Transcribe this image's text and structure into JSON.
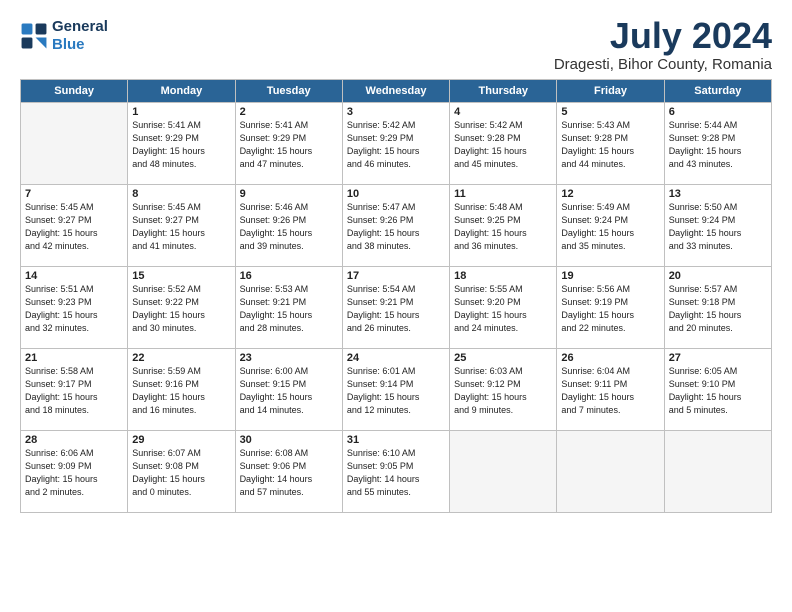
{
  "logo": {
    "line1": "General",
    "line2": "Blue"
  },
  "title": "July 2024",
  "subtitle": "Dragesti, Bihor County, Romania",
  "days_of_week": [
    "Sunday",
    "Monday",
    "Tuesday",
    "Wednesday",
    "Thursday",
    "Friday",
    "Saturday"
  ],
  "weeks": [
    [
      {
        "day": "",
        "detail": ""
      },
      {
        "day": "1",
        "detail": "Sunrise: 5:41 AM\nSunset: 9:29 PM\nDaylight: 15 hours\nand 48 minutes."
      },
      {
        "day": "2",
        "detail": "Sunrise: 5:41 AM\nSunset: 9:29 PM\nDaylight: 15 hours\nand 47 minutes."
      },
      {
        "day": "3",
        "detail": "Sunrise: 5:42 AM\nSunset: 9:29 PM\nDaylight: 15 hours\nand 46 minutes."
      },
      {
        "day": "4",
        "detail": "Sunrise: 5:42 AM\nSunset: 9:28 PM\nDaylight: 15 hours\nand 45 minutes."
      },
      {
        "day": "5",
        "detail": "Sunrise: 5:43 AM\nSunset: 9:28 PM\nDaylight: 15 hours\nand 44 minutes."
      },
      {
        "day": "6",
        "detail": "Sunrise: 5:44 AM\nSunset: 9:28 PM\nDaylight: 15 hours\nand 43 minutes."
      }
    ],
    [
      {
        "day": "7",
        "detail": "Sunrise: 5:45 AM\nSunset: 9:27 PM\nDaylight: 15 hours\nand 42 minutes."
      },
      {
        "day": "8",
        "detail": "Sunrise: 5:45 AM\nSunset: 9:27 PM\nDaylight: 15 hours\nand 41 minutes."
      },
      {
        "day": "9",
        "detail": "Sunrise: 5:46 AM\nSunset: 9:26 PM\nDaylight: 15 hours\nand 39 minutes."
      },
      {
        "day": "10",
        "detail": "Sunrise: 5:47 AM\nSunset: 9:26 PM\nDaylight: 15 hours\nand 38 minutes."
      },
      {
        "day": "11",
        "detail": "Sunrise: 5:48 AM\nSunset: 9:25 PM\nDaylight: 15 hours\nand 36 minutes."
      },
      {
        "day": "12",
        "detail": "Sunrise: 5:49 AM\nSunset: 9:24 PM\nDaylight: 15 hours\nand 35 minutes."
      },
      {
        "day": "13",
        "detail": "Sunrise: 5:50 AM\nSunset: 9:24 PM\nDaylight: 15 hours\nand 33 minutes."
      }
    ],
    [
      {
        "day": "14",
        "detail": "Sunrise: 5:51 AM\nSunset: 9:23 PM\nDaylight: 15 hours\nand 32 minutes."
      },
      {
        "day": "15",
        "detail": "Sunrise: 5:52 AM\nSunset: 9:22 PM\nDaylight: 15 hours\nand 30 minutes."
      },
      {
        "day": "16",
        "detail": "Sunrise: 5:53 AM\nSunset: 9:21 PM\nDaylight: 15 hours\nand 28 minutes."
      },
      {
        "day": "17",
        "detail": "Sunrise: 5:54 AM\nSunset: 9:21 PM\nDaylight: 15 hours\nand 26 minutes."
      },
      {
        "day": "18",
        "detail": "Sunrise: 5:55 AM\nSunset: 9:20 PM\nDaylight: 15 hours\nand 24 minutes."
      },
      {
        "day": "19",
        "detail": "Sunrise: 5:56 AM\nSunset: 9:19 PM\nDaylight: 15 hours\nand 22 minutes."
      },
      {
        "day": "20",
        "detail": "Sunrise: 5:57 AM\nSunset: 9:18 PM\nDaylight: 15 hours\nand 20 minutes."
      }
    ],
    [
      {
        "day": "21",
        "detail": "Sunrise: 5:58 AM\nSunset: 9:17 PM\nDaylight: 15 hours\nand 18 minutes."
      },
      {
        "day": "22",
        "detail": "Sunrise: 5:59 AM\nSunset: 9:16 PM\nDaylight: 15 hours\nand 16 minutes."
      },
      {
        "day": "23",
        "detail": "Sunrise: 6:00 AM\nSunset: 9:15 PM\nDaylight: 15 hours\nand 14 minutes."
      },
      {
        "day": "24",
        "detail": "Sunrise: 6:01 AM\nSunset: 9:14 PM\nDaylight: 15 hours\nand 12 minutes."
      },
      {
        "day": "25",
        "detail": "Sunrise: 6:03 AM\nSunset: 9:12 PM\nDaylight: 15 hours\nand 9 minutes."
      },
      {
        "day": "26",
        "detail": "Sunrise: 6:04 AM\nSunset: 9:11 PM\nDaylight: 15 hours\nand 7 minutes."
      },
      {
        "day": "27",
        "detail": "Sunrise: 6:05 AM\nSunset: 9:10 PM\nDaylight: 15 hours\nand 5 minutes."
      }
    ],
    [
      {
        "day": "28",
        "detail": "Sunrise: 6:06 AM\nSunset: 9:09 PM\nDaylight: 15 hours\nand 2 minutes."
      },
      {
        "day": "29",
        "detail": "Sunrise: 6:07 AM\nSunset: 9:08 PM\nDaylight: 15 hours\nand 0 minutes."
      },
      {
        "day": "30",
        "detail": "Sunrise: 6:08 AM\nSunset: 9:06 PM\nDaylight: 14 hours\nand 57 minutes."
      },
      {
        "day": "31",
        "detail": "Sunrise: 6:10 AM\nSunset: 9:05 PM\nDaylight: 14 hours\nand 55 minutes."
      },
      {
        "day": "",
        "detail": ""
      },
      {
        "day": "",
        "detail": ""
      },
      {
        "day": "",
        "detail": ""
      }
    ]
  ]
}
